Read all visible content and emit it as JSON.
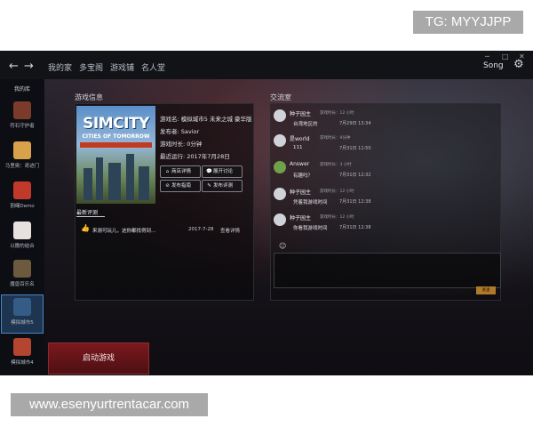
{
  "watermarks": {
    "top": "TG: MYYJJPP",
    "bottom": "www.esenyurtrentacar.com"
  },
  "window": {
    "minimize": "─",
    "maximize": "□",
    "close": "✕"
  },
  "nav": {
    "back_icon": "arrow-left-icon",
    "forward_icon": "arrow-right-icon",
    "items": [
      "我的家",
      "多宝阁",
      "游戏铺",
      "名人堂"
    ]
  },
  "user": {
    "name": "Song",
    "settings_icon": "gear-icon"
  },
  "sidebar": {
    "title": "我的库",
    "items": [
      {
        "label": "符石守护者"
      },
      {
        "label": "马里奥：奇迹门"
      },
      {
        "label": "割绳Demo"
      },
      {
        "label": "以撒的结合"
      },
      {
        "label": "魔兽百乐名"
      },
      {
        "label": "模拟城市5"
      },
      {
        "label": "模拟城市4"
      }
    ]
  },
  "game_info": {
    "section_title": "游戏信息",
    "cover": {
      "title": "SIMCITY",
      "subtitle": "CITIES OF TOMORROW"
    },
    "name_line": "游戏名: 模拟城市5 未来之城 豪华版",
    "publisher_line": "发布者: Savior",
    "playtime_line": "游戏时长: 0分钟",
    "last_played_line": "最近运行: 2017年7月28日",
    "buttons": {
      "store": "商店详情",
      "discuss": "展开讨论",
      "guide": "发布指南",
      "review": "发布评测"
    },
    "reviews_tab": "最新评测",
    "review": {
      "text": "来测可玩儿，这你都找得到…",
      "date": "2017-7-28",
      "link": "查看详情"
    }
  },
  "chat": {
    "section_title": "交流室",
    "messages": [
      {
        "name": "种子园主",
        "meta": "游戏时长：12 小时",
        "text": "台湾地区的",
        "time": "7月29日 13:34"
      },
      {
        "name": "是world",
        "meta": "游戏时长：9分钟",
        "text": "111",
        "time": "7月31日 11:50"
      },
      {
        "name": "Answer",
        "meta": "游戏时长：3 小时",
        "text": "有趣吗？",
        "time": "7月31日 12:32"
      },
      {
        "name": "种子园主",
        "meta": "游戏时长：12 小时",
        "text": "凭着我游戏时间",
        "time": "7月31日 12:38"
      },
      {
        "name": "种子园主",
        "meta": "游戏时长：12 小时",
        "text": "你看我游戏时间",
        "time": "7月31日 12:38"
      }
    ],
    "emoji_icon": "smile-icon",
    "send_label": "发送"
  },
  "launch_button": "启动游戏",
  "colors": {
    "accent_active": "#4c86c6",
    "launch_red": "#7a1a1e",
    "send_orange": "#b07a2a"
  }
}
